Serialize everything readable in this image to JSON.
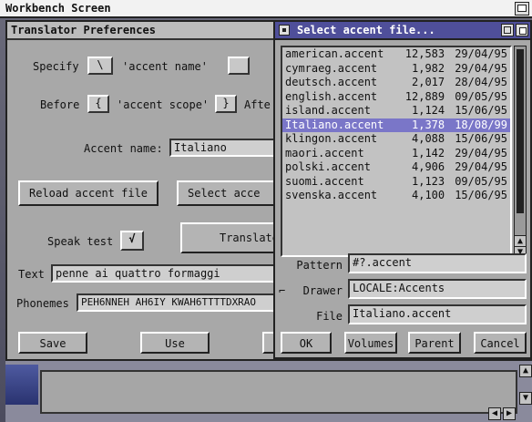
{
  "screen": {
    "title": "Workbench Screen"
  },
  "prefs": {
    "title": "Translator Preferences",
    "specify_label": "Specify",
    "specify_value": "\\",
    "accent_name_quote": "'accent name'",
    "before_label": "Before",
    "before_value": "{",
    "accent_scope_quote": "'accent scope'",
    "after_value": "}",
    "after_label": "Afte",
    "accent_name_label": "Accent name:",
    "accent_name_value": "Italiano",
    "reload_button": "Reload accent file",
    "select_button": "Select acce",
    "speak_test_label": "Speak test",
    "speak_test_checked": "√",
    "translate_button": "Translate",
    "text_label": "Text",
    "text_value": "penne ai quattro formaggi",
    "phonemes_label": "Phonemes",
    "phonemes_value": "PEH6NNEH AH6IY KWAH6TTTTDXRAO",
    "save_button": "Save",
    "use_button": "Use"
  },
  "requester": {
    "title": "Select accent file...",
    "files": [
      {
        "name": "american.accent",
        "size": "12,583",
        "date": "29/04/95"
      },
      {
        "name": "cymraeg.accent",
        "size": "1,982",
        "date": "29/04/95"
      },
      {
        "name": "deutsch.accent",
        "size": "2,017",
        "date": "28/04/95"
      },
      {
        "name": "english.accent",
        "size": "12,889",
        "date": "09/05/95"
      },
      {
        "name": "island.accent",
        "size": "1,124",
        "date": "15/06/95"
      },
      {
        "name": "Italiano.accent",
        "size": "1,378",
        "date": "18/08/99"
      },
      {
        "name": "klingon.accent",
        "size": "4,088",
        "date": "15/06/95"
      },
      {
        "name": "maori.accent",
        "size": "1,142",
        "date": "29/04/95"
      },
      {
        "name": "polski.accent",
        "size": "4,906",
        "date": "29/04/95"
      },
      {
        "name": "suomi.accent",
        "size": "1,123",
        "date": "09/05/95"
      },
      {
        "name": "svenska.accent",
        "size": "4,100",
        "date": "15/06/95"
      }
    ],
    "selected_index": 5,
    "pattern_label": "Pattern",
    "pattern_value": "#?.accent",
    "drawer_label": "Drawer",
    "drawer_value": "LOCALE:Accents",
    "file_label": "File",
    "file_value": "Italiano.accent",
    "ok_button": "OK",
    "volumes_button": "Volumes",
    "parent_button": "Parent",
    "cancel_button": "Cancel"
  },
  "colors": {
    "selection": "#7a76c8",
    "requester_title": "#4f4f9a",
    "window_bg": "#a8a8a8"
  }
}
